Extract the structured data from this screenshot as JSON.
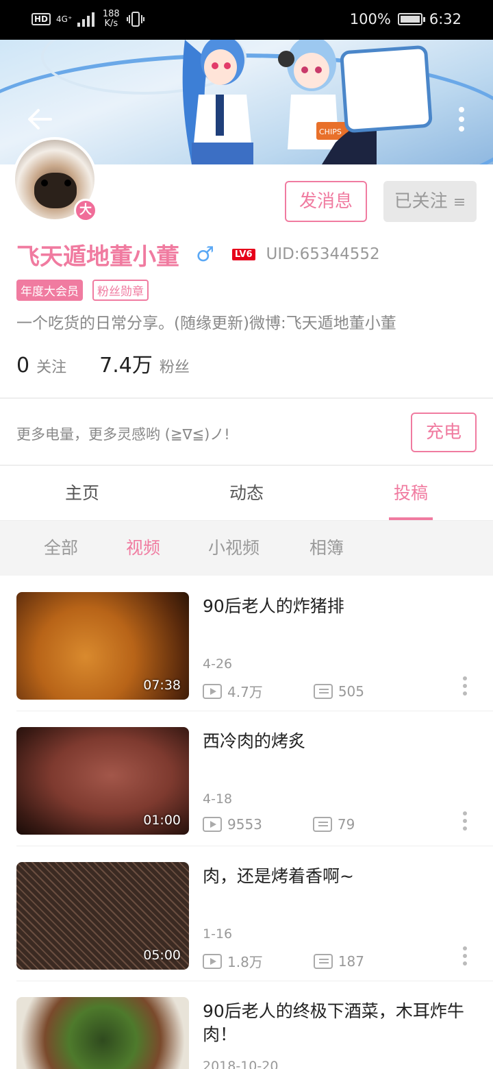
{
  "status_bar": {
    "hd": "HD",
    "network": "4G⁺",
    "speed_value": "188",
    "speed_unit": "K/s",
    "battery_pct": "100%",
    "time": "6:32"
  },
  "profile": {
    "name": "飞天遁地董小董",
    "gender_symbol": "♂",
    "level": "LV6",
    "uid": "UID:65344552",
    "vip_badge": "大",
    "tags": [
      "年度大会员",
      "粉丝勋章"
    ],
    "bio": "一个吃货的日常分享。(随缘更新)微博:飞天遁地董小董",
    "following_count": "0",
    "following_label": "关注",
    "fans_count": "7.4万",
    "fans_label": "粉丝"
  },
  "actions": {
    "message_label": "发消息",
    "follow_label": "已关注",
    "follow_icon": "≡"
  },
  "charge": {
    "text": "更多电量，更多灵感哟 (≧∇≦)ノ!",
    "button_label": "充电"
  },
  "tabs": [
    {
      "label": "主页"
    },
    {
      "label": "动态"
    },
    {
      "label": "投稿"
    }
  ],
  "active_tab": "投稿",
  "subtabs": [
    {
      "label": "全部"
    },
    {
      "label": "视频"
    },
    {
      "label": "小视频"
    },
    {
      "label": "相簿"
    }
  ],
  "active_subtab": "视频",
  "videos": [
    {
      "title": "90后老人的炸猪排",
      "date": "4-26",
      "duration": "07:38",
      "views": "4.7万",
      "danmaku": "505"
    },
    {
      "title": "西冷肉的烤炙",
      "date": "4-18",
      "duration": "01:00",
      "views": "9553",
      "danmaku": "79"
    },
    {
      "title": "肉，还是烤着香啊~",
      "date": "1-16",
      "duration": "05:00",
      "views": "1.8万",
      "danmaku": "187"
    },
    {
      "title": "90后老人的终极下酒菜，木耳炸牛肉！",
      "date": "2018-10-20",
      "duration": "",
      "views": "",
      "danmaku": ""
    }
  ],
  "colors": {
    "accent": "#f07ba0",
    "status_bar": "#000000",
    "follow_bg": "#e8e8e8"
  },
  "icons": {
    "back": "back-arrow-icon",
    "more": "more-vertical-icon",
    "play": "play-count-icon",
    "danmaku": "danmaku-icon"
  }
}
